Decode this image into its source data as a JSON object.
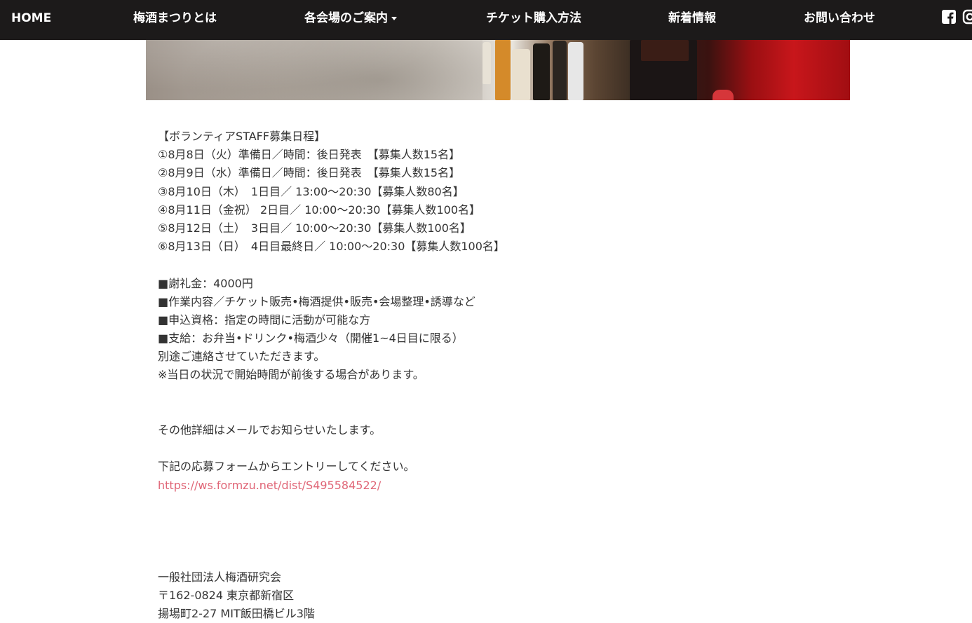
{
  "nav": {
    "items": [
      {
        "label": "HOME"
      },
      {
        "label": "梅酒まつりとは"
      },
      {
        "label": "各会場のご案内"
      },
      {
        "label": "チケット購入方法"
      },
      {
        "label": "新着情報"
      },
      {
        "label": "お問い合わせ"
      }
    ],
    "icons": [
      "facebook-icon",
      "instagram-icon"
    ]
  },
  "schedule": {
    "heading": "【ボランティアSTAFF募集日程】",
    "rows": [
      "①8月8日（火）準備日／時間：後日発表　【募集人数15名】",
      "②8月9日（水）準備日／時間：後日発表　【募集人数15名】",
      "③8月10日（木）　1日目／ 13:00〜20:30【募集人数80名】",
      "④8月11日（金祝） 2日目／ 10:00〜20:30【募集人数100名】",
      "⑤8月12日（土）　3日目／ 10:00〜20:30【募集人数100名】",
      "⑥8月13日（日）　4日目最終日／ 10:00〜20:30【募集人数100名】"
    ]
  },
  "details": {
    "lines": [
      "■謝礼金：4000円",
      "■作業内容／チケット販売•梅酒提供•販売•会場整理•誘導など",
      "■申込資格：指定の時間に活動が可能な方",
      "■支給：お弁当•ドリンク•梅酒少々（開催1~4日目に限る）",
      "別途ご連絡させていただきます。",
      "※当日の状況で開始時間が前後する場合があります。"
    ]
  },
  "info": {
    "mail_note": "その他詳細はメールでお知らせいたします。",
    "form_note": "下記の応募フォームからエントリーしてください。",
    "form_url": "https://ws.formzu.net/dist/S495584522/"
  },
  "org": {
    "name": "一般社団法人梅酒研究会",
    "postal": "〒162-0824 東京都新宿区",
    "address": "揚場町2-27 MIT飯田橋ビル3階"
  },
  "colors": {
    "nav_bg": "#1c1a1a",
    "link": "#e06677",
    "text": "#333333"
  }
}
